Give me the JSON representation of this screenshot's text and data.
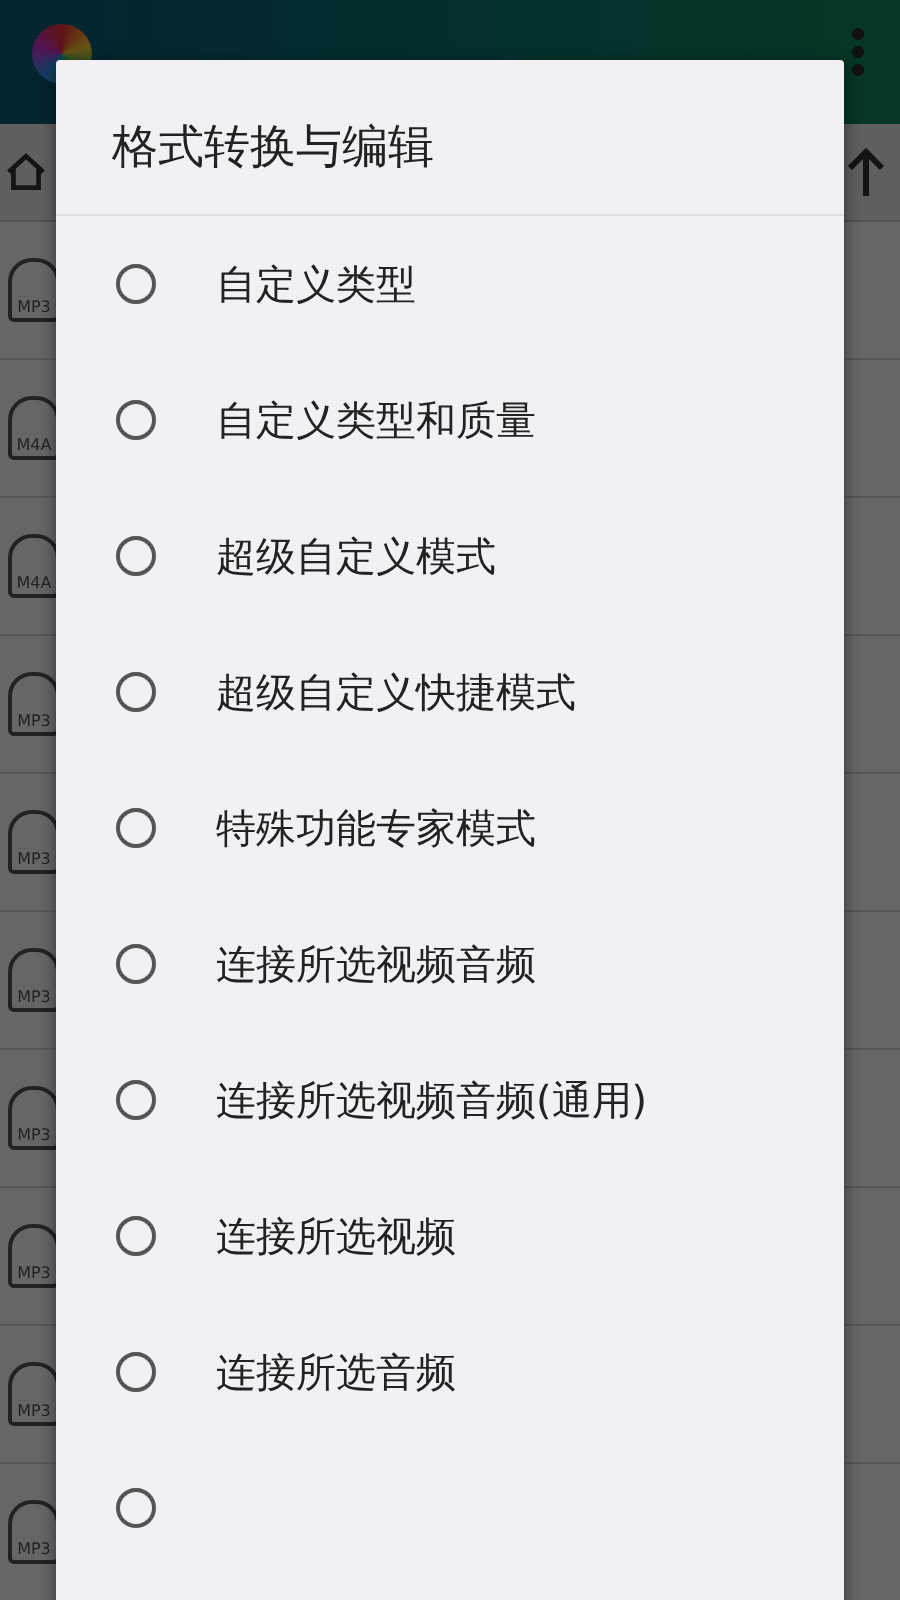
{
  "app": {
    "files": [
      {
        "type": "MP3"
      },
      {
        "type": "M4A"
      },
      {
        "type": "M4A"
      },
      {
        "type": "MP3"
      },
      {
        "type": "MP3"
      },
      {
        "type": "MP3"
      },
      {
        "type": "MP3"
      },
      {
        "type": "MP3"
      },
      {
        "type": "MP3"
      },
      {
        "type": "MP3"
      }
    ]
  },
  "dialog": {
    "title": "格式转换与编辑",
    "options": [
      {
        "label": "自定义类型",
        "selected": false
      },
      {
        "label": "自定义类型和质量",
        "selected": false
      },
      {
        "label": "超级自定义模式",
        "selected": false
      },
      {
        "label": "超级自定义快捷模式",
        "selected": false
      },
      {
        "label": "特殊功能专家模式",
        "selected": false
      },
      {
        "label": "连接所选视频音频",
        "selected": false
      },
      {
        "label": "连接所选视频音频(通用)",
        "selected": false
      },
      {
        "label": "连接所选视频",
        "selected": false
      },
      {
        "label": "连接所选音频",
        "selected": false
      },
      {
        "selected": false
      }
    ]
  }
}
